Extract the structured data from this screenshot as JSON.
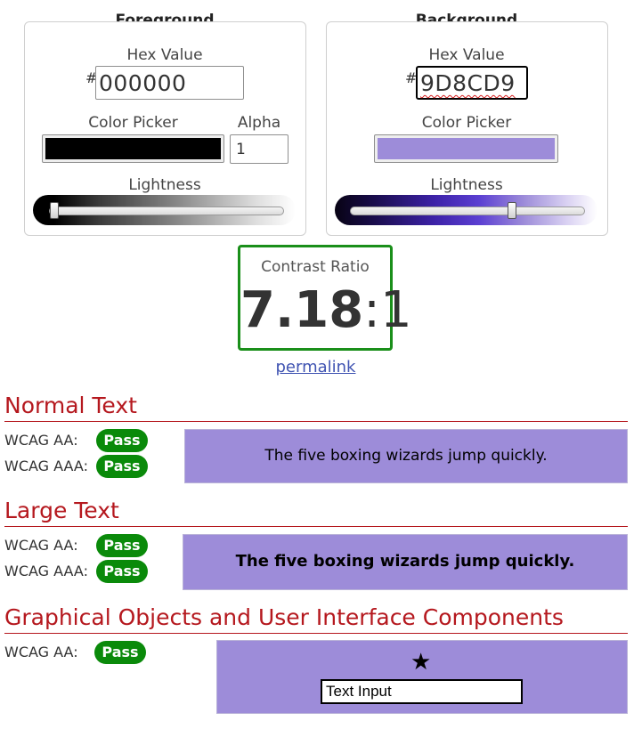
{
  "foreground": {
    "title": "Foreground",
    "hex_label": "Hex Value",
    "hash": "#",
    "hex_value": "000000",
    "picker_label": "Color Picker",
    "alpha_label": "Alpha",
    "alpha_value": "1",
    "lightness_label": "Lightness",
    "color": "#000000",
    "lightness_level": 0.0
  },
  "background": {
    "title": "Background",
    "hex_label": "Hex Value",
    "hash": "#",
    "hex_value": "9D8CD9",
    "picker_label": "Color Picker",
    "lightness_label": "Lightness",
    "color": "#9d8cd9",
    "lightness_level": 0.7
  },
  "contrast": {
    "label": "Contrast Ratio",
    "value": "7.18",
    "separator": ":",
    "suffix": "1",
    "permalink": "permalink"
  },
  "normal_text": {
    "heading": "Normal Text",
    "rows": [
      {
        "label": "WCAG AA:",
        "result": "Pass"
      },
      {
        "label": "WCAG AAA:",
        "result": "Pass"
      }
    ],
    "sample": "The five boxing wizards jump quickly."
  },
  "large_text": {
    "heading": "Large Text",
    "rows": [
      {
        "label": "WCAG AA:",
        "result": "Pass"
      },
      {
        "label": "WCAG AAA:",
        "result": "Pass"
      }
    ],
    "sample": "The five boxing wizards jump quickly."
  },
  "graphical": {
    "heading": "Graphical Objects and User Interface Components",
    "rows": [
      {
        "label": "WCAG AA:",
        "result": "Pass"
      }
    ],
    "star_icon": "star-icon",
    "input_text": "Text Input"
  },
  "colors": {
    "heading_red": "#b5181e",
    "pass_green": "#0a8a0a",
    "ratio_border": "#1a8f1a",
    "link_blue": "#4054b2"
  }
}
